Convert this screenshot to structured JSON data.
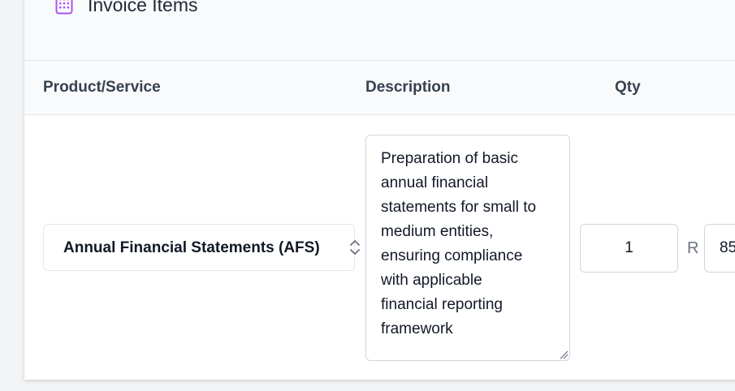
{
  "section": {
    "title": "Invoice Items",
    "icon": "calculator-icon"
  },
  "table": {
    "columns": [
      "Product/Service",
      "Description",
      "Qty"
    ],
    "rows": [
      {
        "product": "Annual Financial Statements (AFS)",
        "description": "Preparation of basic\nannual financial\nstatements for small to\nmedium entities,\nensuring compliance\nwith applicable\nfinancial reporting\nframework",
        "qty": "1",
        "currency": "R",
        "price": "85"
      }
    ]
  },
  "colors": {
    "accent": "#a855f7",
    "header_bg": "#f9fafb",
    "border": "#e5e7eb"
  }
}
